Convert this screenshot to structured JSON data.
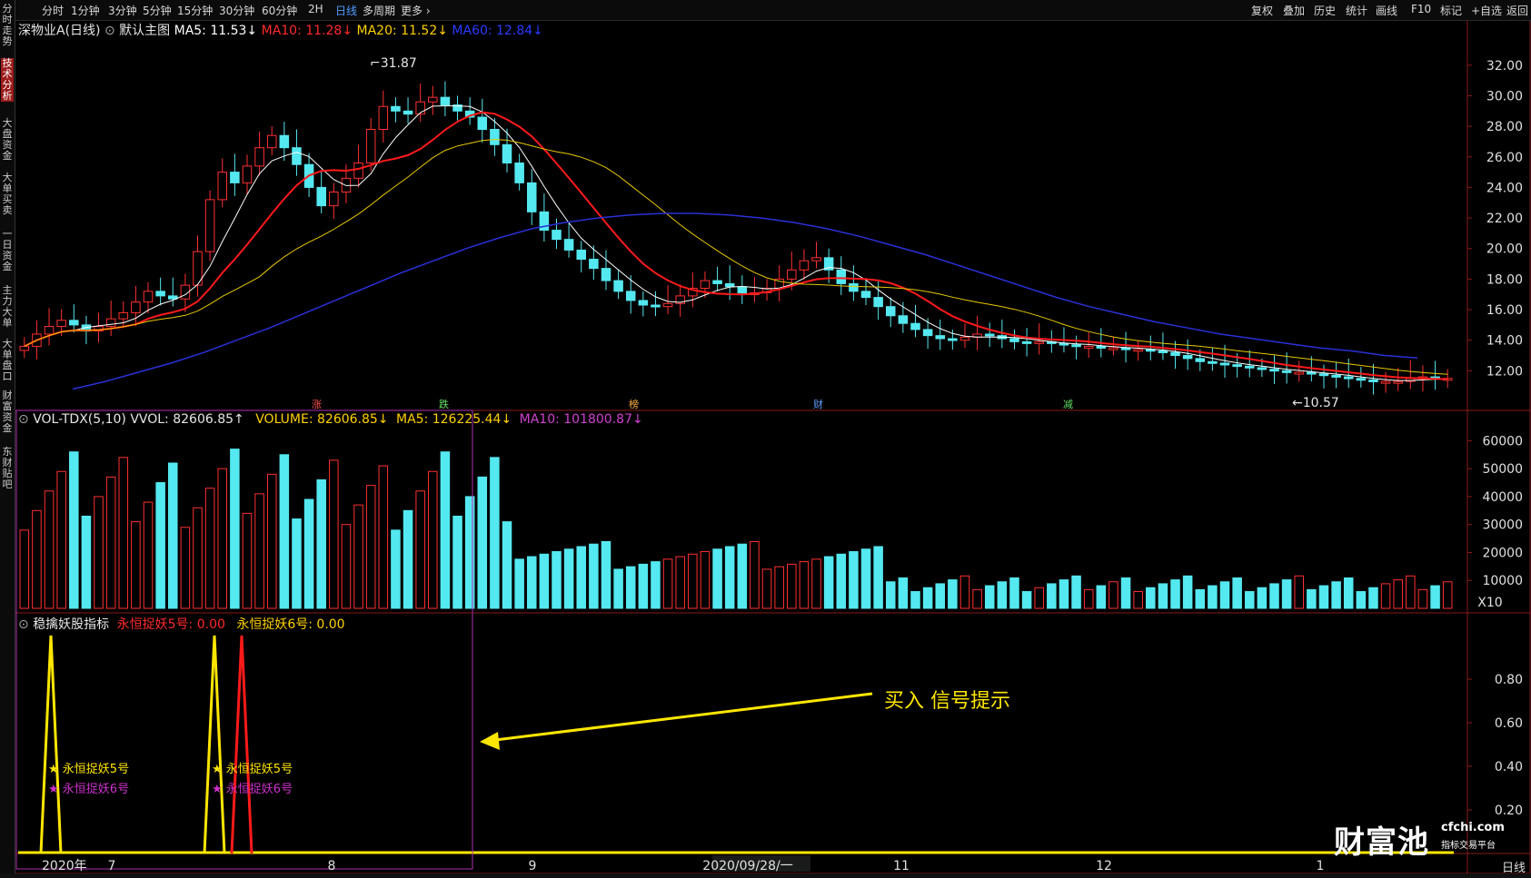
{
  "toolbar": {
    "timeframes": [
      "分时",
      "1分钟",
      "3分钟",
      "5分钟",
      "15分钟",
      "30分钟",
      "60分钟",
      "2H",
      "日线",
      "多周期",
      "更多"
    ],
    "active": "日线",
    "right": [
      "复权",
      "叠加",
      "历史",
      "统计",
      "画线",
      "F10",
      "标记",
      "+自选",
      "返回"
    ]
  },
  "sidenav": [
    "分时走势",
    "技术分析",
    "大盘资金",
    "大单买卖",
    "一日资金",
    "主力大单",
    "大单盘口",
    "财富资金",
    "东财贴吧"
  ],
  "price_panel": {
    "stock": "深物业A(日线)",
    "main_label": "默认主图",
    "ma5": "MA5: 11.53↓",
    "ma10": "MA10: 11.28↓",
    "ma20": "MA20: 11.52↓",
    "ma60": "MA60: 12.84↓",
    "high_label": "31.87",
    "low_label": "10.57",
    "yticks": [
      "32.00",
      "30.00",
      "28.00",
      "26.00",
      "24.00",
      "22.00",
      "20.00",
      "18.00",
      "16.00",
      "14.00",
      "12.00"
    ],
    "markers": [
      "涨",
      "跌",
      "榜",
      "财",
      "减"
    ]
  },
  "volume_panel": {
    "title": "VOL-TDX(5,10) VVOL: 82606.85↑",
    "volume": "VOLUME: 82606.85↓",
    "ma5": "MA5: 126225.44↓",
    "ma10": "MA10: 101800.87↓",
    "yticks": [
      "60000",
      "50000",
      "40000",
      "30000",
      "20000",
      "10000"
    ],
    "unit": "X10"
  },
  "indicator_panel": {
    "title": "稳擒妖股指标",
    "v5": "永恒捉妖5号: 0.00",
    "v6": "永恒捉妖6号: 0.00",
    "yticks": [
      "0.80",
      "0.60",
      "0.40",
      "0.20"
    ],
    "sig5": "永恒捉妖5号",
    "sig6": "永恒捉妖6号",
    "sig5b": "永恒捉妖5号",
    "sig6b": "永恒捉妖6号",
    "annotation": "买入 信号提示"
  },
  "xaxis": [
    "2020年",
    "7",
    "8",
    "9",
    "2020/09/28/一",
    "11",
    "12",
    "1"
  ],
  "period_button": "日线",
  "watermark": {
    "brand": "财富池",
    "site": "cfchi.com",
    "tagline": "指标交易平台"
  },
  "chart_data": {
    "type": "candlestick",
    "price_ylim": [
      10,
      33
    ],
    "close_series": [
      13.6,
      14.4,
      14.9,
      15.3,
      15.0,
      14.6,
      14.9,
      15.4,
      15.8,
      16.5,
      17.2,
      16.9,
      16.7,
      17.6,
      19.8,
      23.2,
      25.0,
      24.3,
      25.4,
      26.6,
      27.4,
      26.6,
      25.5,
      24.0,
      22.8,
      23.7,
      24.6,
      25.6,
      27.8,
      29.3,
      29.0,
      28.8,
      29.6,
      29.9,
      29.4,
      29.0,
      28.6,
      27.8,
      26.8,
      25.6,
      24.3,
      22.4,
      21.2,
      20.6,
      19.9,
      19.3,
      18.7,
      17.9,
      17.2,
      16.6,
      16.3,
      16.2,
      16.4,
      16.9,
      17.4,
      17.9,
      17.7,
      17.5,
      17.1,
      17.1,
      17.4,
      18.0,
      18.6,
      19.2,
      19.4,
      18.6,
      17.7,
      17.2,
      16.8,
      16.2,
      15.6,
      15.1,
      14.7,
      14.3,
      14.1,
      14.0,
      14.2,
      14.4,
      14.3,
      14.1,
      13.9,
      13.8,
      13.9,
      13.8,
      13.7,
      13.6,
      13.6,
      13.5,
      13.5,
      13.4,
      13.4,
      13.3,
      13.2,
      13.0,
      12.8,
      12.6,
      12.5,
      12.4,
      12.3,
      12.2,
      12.1,
      12.0,
      11.9,
      11.9,
      11.8,
      11.7,
      11.6,
      11.5,
      11.4,
      11.3,
      11.3,
      11.3,
      11.5,
      11.6,
      11.5,
      11.5
    ],
    "ma60": [
      10.8,
      11.3,
      11.9,
      12.5,
      13.2,
      14.0,
      14.8,
      15.7,
      16.6,
      17.5,
      18.4,
      19.2,
      20.0,
      20.7,
      21.3,
      21.7,
      22.0,
      22.2,
      22.3,
      22.3,
      22.2,
      22.0,
      21.7,
      21.3,
      20.8,
      20.2,
      19.6,
      18.9,
      18.2,
      17.5,
      16.8,
      16.2,
      15.7,
      15.2,
      14.8,
      14.4,
      14.1,
      13.8,
      13.5,
      13.3,
      13.0,
      12.84
    ],
    "vol_ylim": [
      0,
      65000
    ],
    "volume_levels": [
      "60000",
      "50000",
      "40000",
      "30000",
      "20000",
      "10000"
    ],
    "signals": [
      {
        "series": "永恒捉妖5号",
        "value": 1
      },
      {
        "series": "永恒捉妖5号",
        "value": 1
      },
      {
        "series": "永恒捉妖6号",
        "value": 1
      }
    ]
  }
}
